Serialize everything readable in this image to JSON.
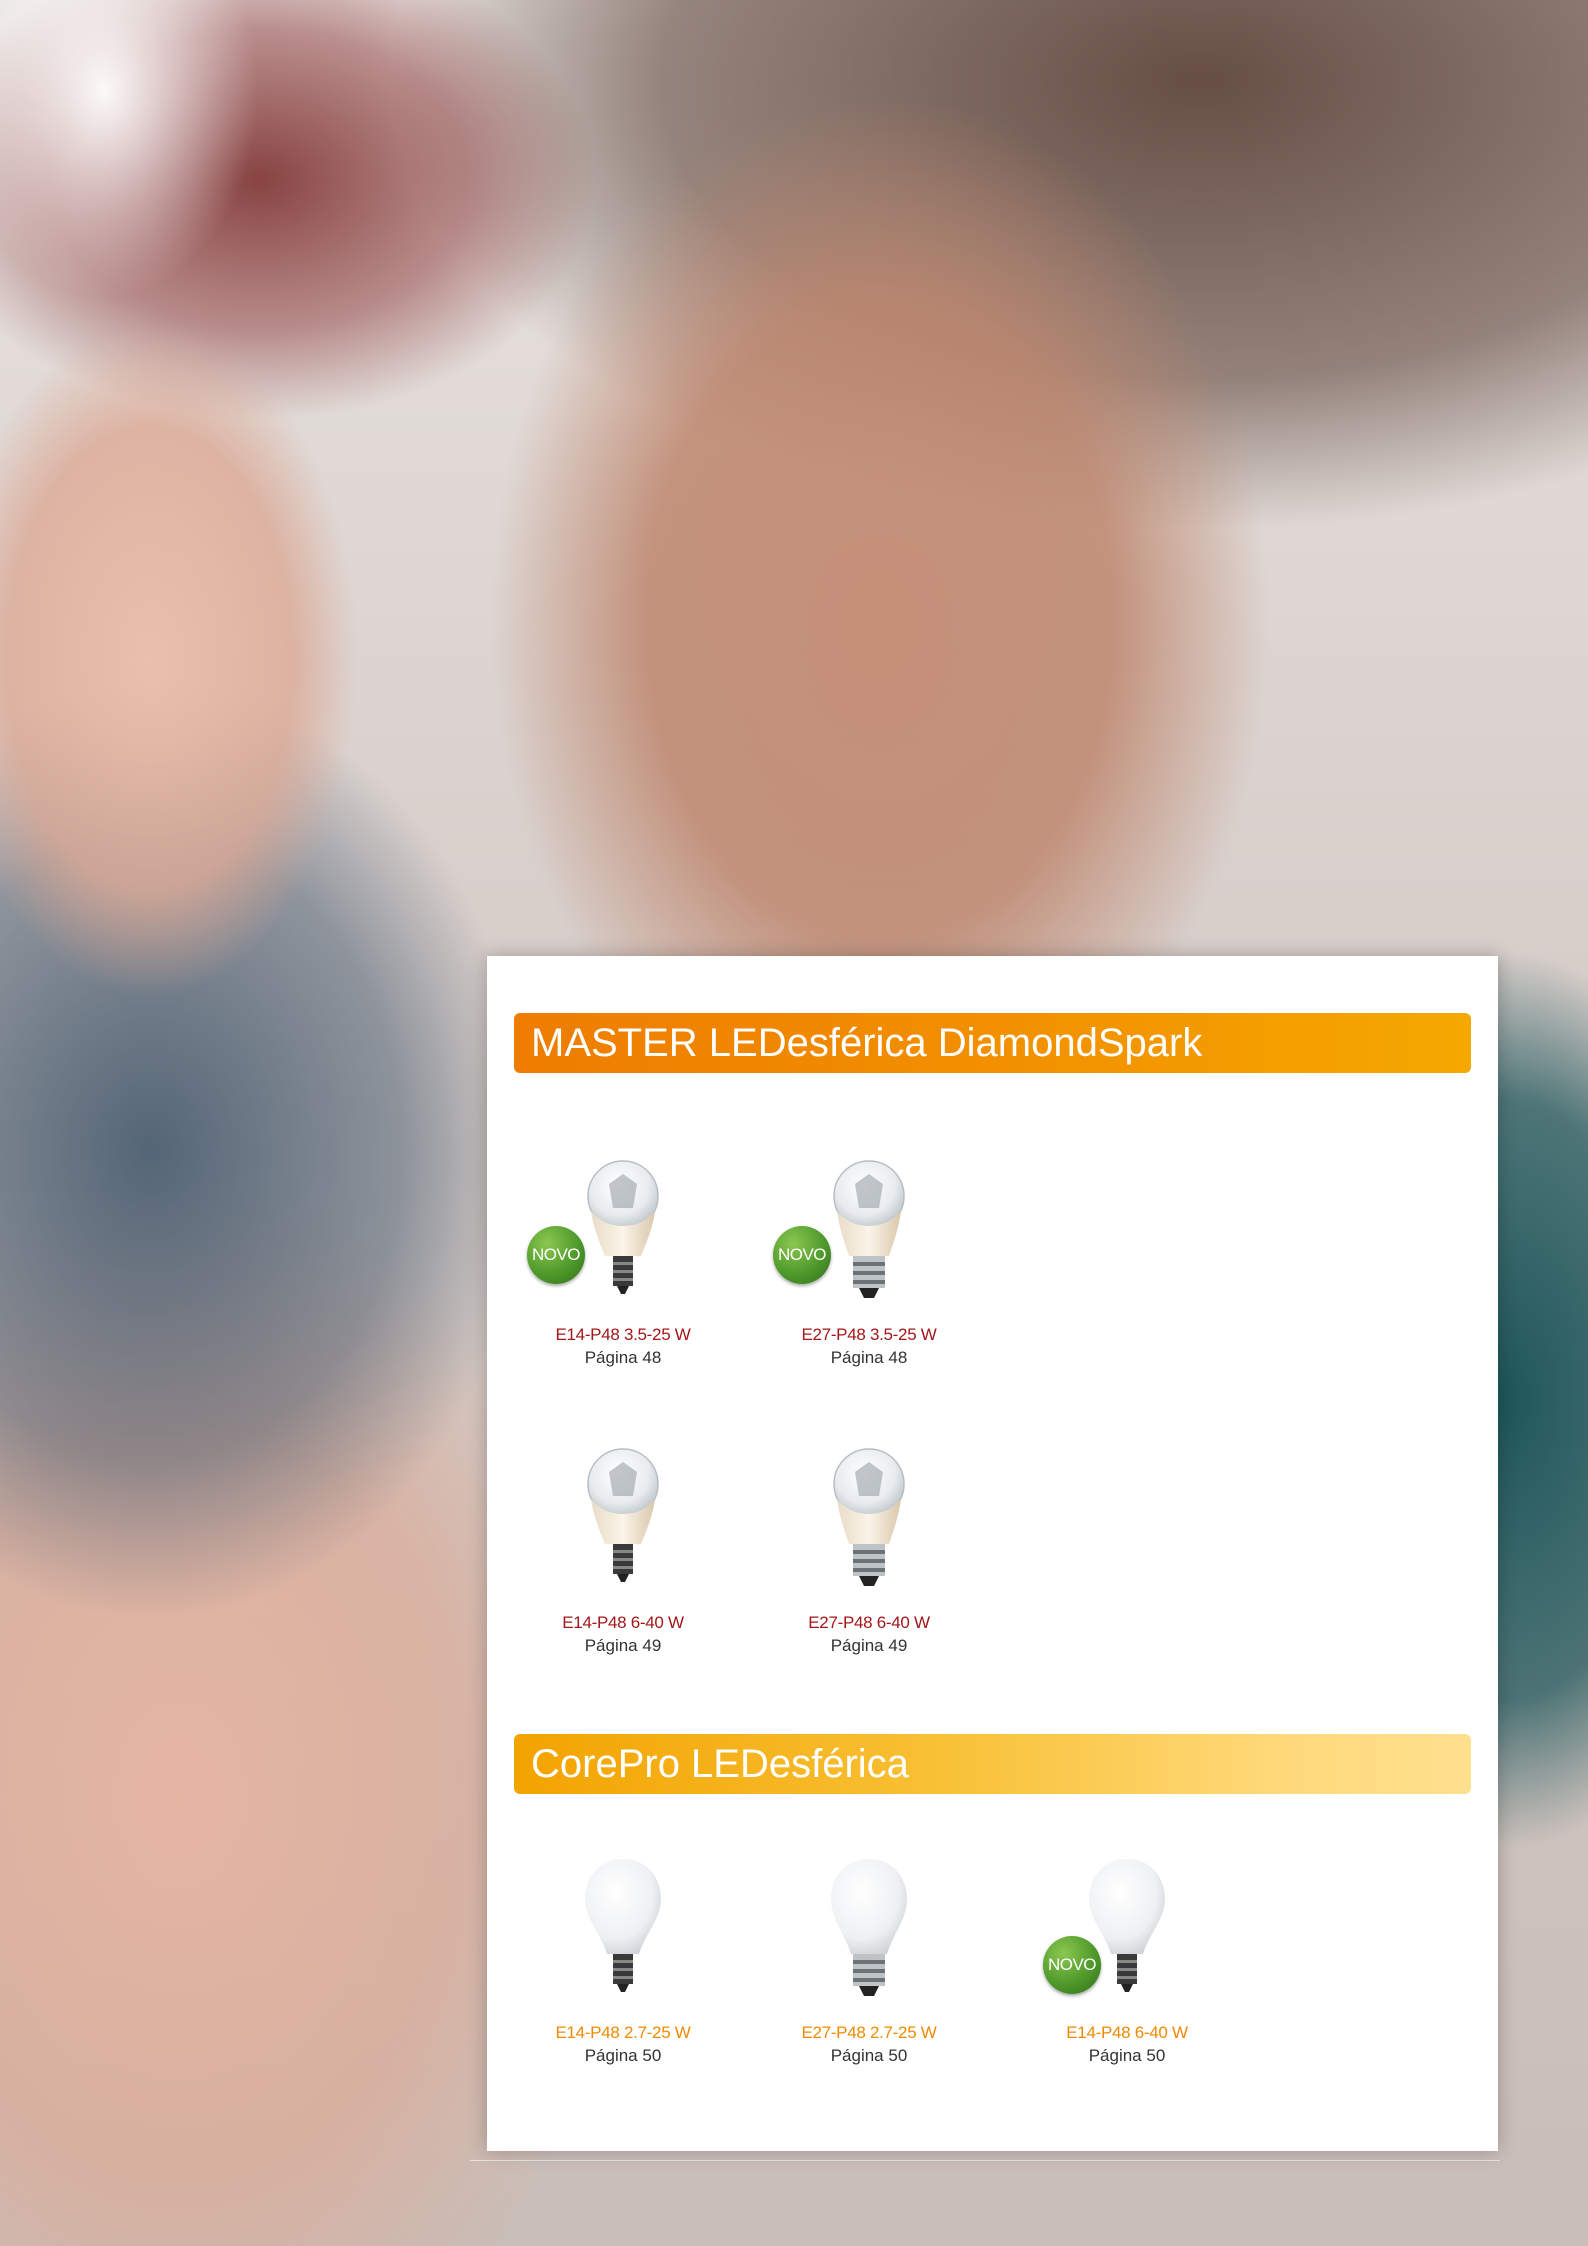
{
  "page": {
    "background_photo": "couple-smiling-photo",
    "accent_colors": {
      "master_bar": "#ee7c00",
      "corepro_bar": "#f8c136",
      "label_red": "#a3161a",
      "label_orange": "#ef8a00",
      "novo_badge": "#4f9a2b"
    }
  },
  "sections": [
    {
      "title": "MASTER LEDesférica DiamondSpark",
      "products": [
        {
          "name": "E14-P48 3.5-25 W",
          "page": "Página 48",
          "badge": "NOVO",
          "base": "E14",
          "style": "clear"
        },
        {
          "name": "E27-P48 3.5-25 W",
          "page": "Página 48",
          "badge": "NOVO",
          "base": "E27",
          "style": "clear"
        },
        {
          "name": "E14-P48 6-40 W",
          "page": "Página 49",
          "badge": "",
          "base": "E14",
          "style": "clear"
        },
        {
          "name": "E27-P48 6-40 W",
          "page": "Página 49",
          "badge": "",
          "base": "E27",
          "style": "clear"
        }
      ]
    },
    {
      "title": "CorePro LEDesférica",
      "products": [
        {
          "name": "E14-P48 2.7-25 W",
          "page": "Página 50",
          "badge": "",
          "base": "E14",
          "style": "frosted"
        },
        {
          "name": "E27-P48 2.7-25 W",
          "page": "Página 50",
          "badge": "",
          "base": "E27",
          "style": "frosted"
        },
        {
          "name": "E14-P48 6-40 W",
          "page": "Página 50",
          "badge": "NOVO",
          "base": "E14",
          "style": "frosted"
        }
      ]
    }
  ]
}
